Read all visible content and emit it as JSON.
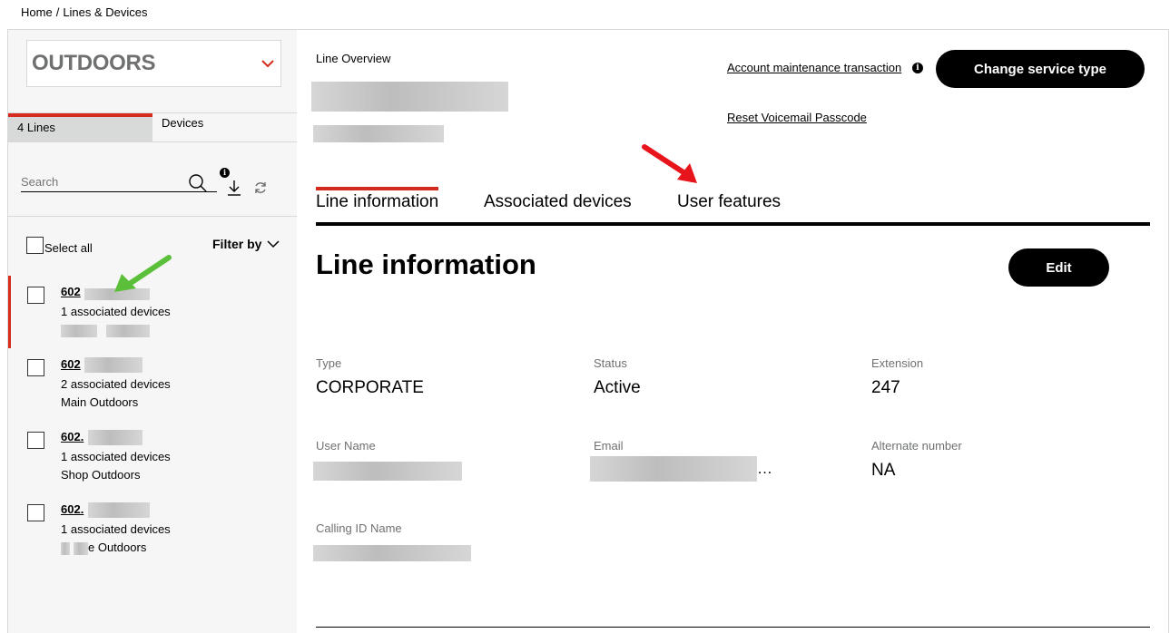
{
  "breadcrumb": {
    "home": "Home",
    "separator": "/",
    "current": "Lines & Devices"
  },
  "sidebar": {
    "account_name": "OUTDOORS",
    "tabs": [
      {
        "label": "4 Lines",
        "active": true
      },
      {
        "label": "Devices",
        "active": false
      }
    ],
    "search_placeholder": "Search",
    "info_glyph": "i",
    "select_all_label": "Select all",
    "filter_label": "Filter by",
    "lines": [
      {
        "number": "602",
        "devices": "1 associated devices",
        "label": "",
        "active": true
      },
      {
        "number": "602",
        "devices": "2 associated devices",
        "label": "Main Outdoors",
        "active": false
      },
      {
        "number": "602.",
        "devices": "1 associated devices",
        "label": "Shop Outdoors",
        "active": false
      },
      {
        "number": "602.",
        "devices": "1 associated devices",
        "label": "e Outdoors",
        "active": false
      }
    ]
  },
  "header": {
    "eyebrow": "Line Overview",
    "maintenance_link": "Account maintenance transaction",
    "info_glyph": "i",
    "voicemail_link": "Reset Voicemail Passcode",
    "change_service_button": "Change service type"
  },
  "tabs": [
    {
      "label": "Line information",
      "active": true
    },
    {
      "label": "Associated devices",
      "active": false
    },
    {
      "label": "User features",
      "active": false
    }
  ],
  "line_info": {
    "title": "Line information",
    "edit_button": "Edit",
    "fields": {
      "type": {
        "label": "Type",
        "value": "CORPORATE"
      },
      "status": {
        "label": "Status",
        "value": "Active"
      },
      "extension": {
        "label": "Extension",
        "value": "247"
      },
      "user_name": {
        "label": "User Name",
        "value": ""
      },
      "email": {
        "label": "Email",
        "value": "…"
      },
      "alternate_number": {
        "label": "Alternate number",
        "value": "NA"
      },
      "calling_id_name": {
        "label": "Calling ID Name",
        "value": ""
      }
    }
  },
  "colors": {
    "accent_red": "#d52b1e",
    "annotation_red": "#e8141b",
    "annotation_green": "#5bbf3a",
    "sidebar_bg": "#f6f6f6"
  }
}
